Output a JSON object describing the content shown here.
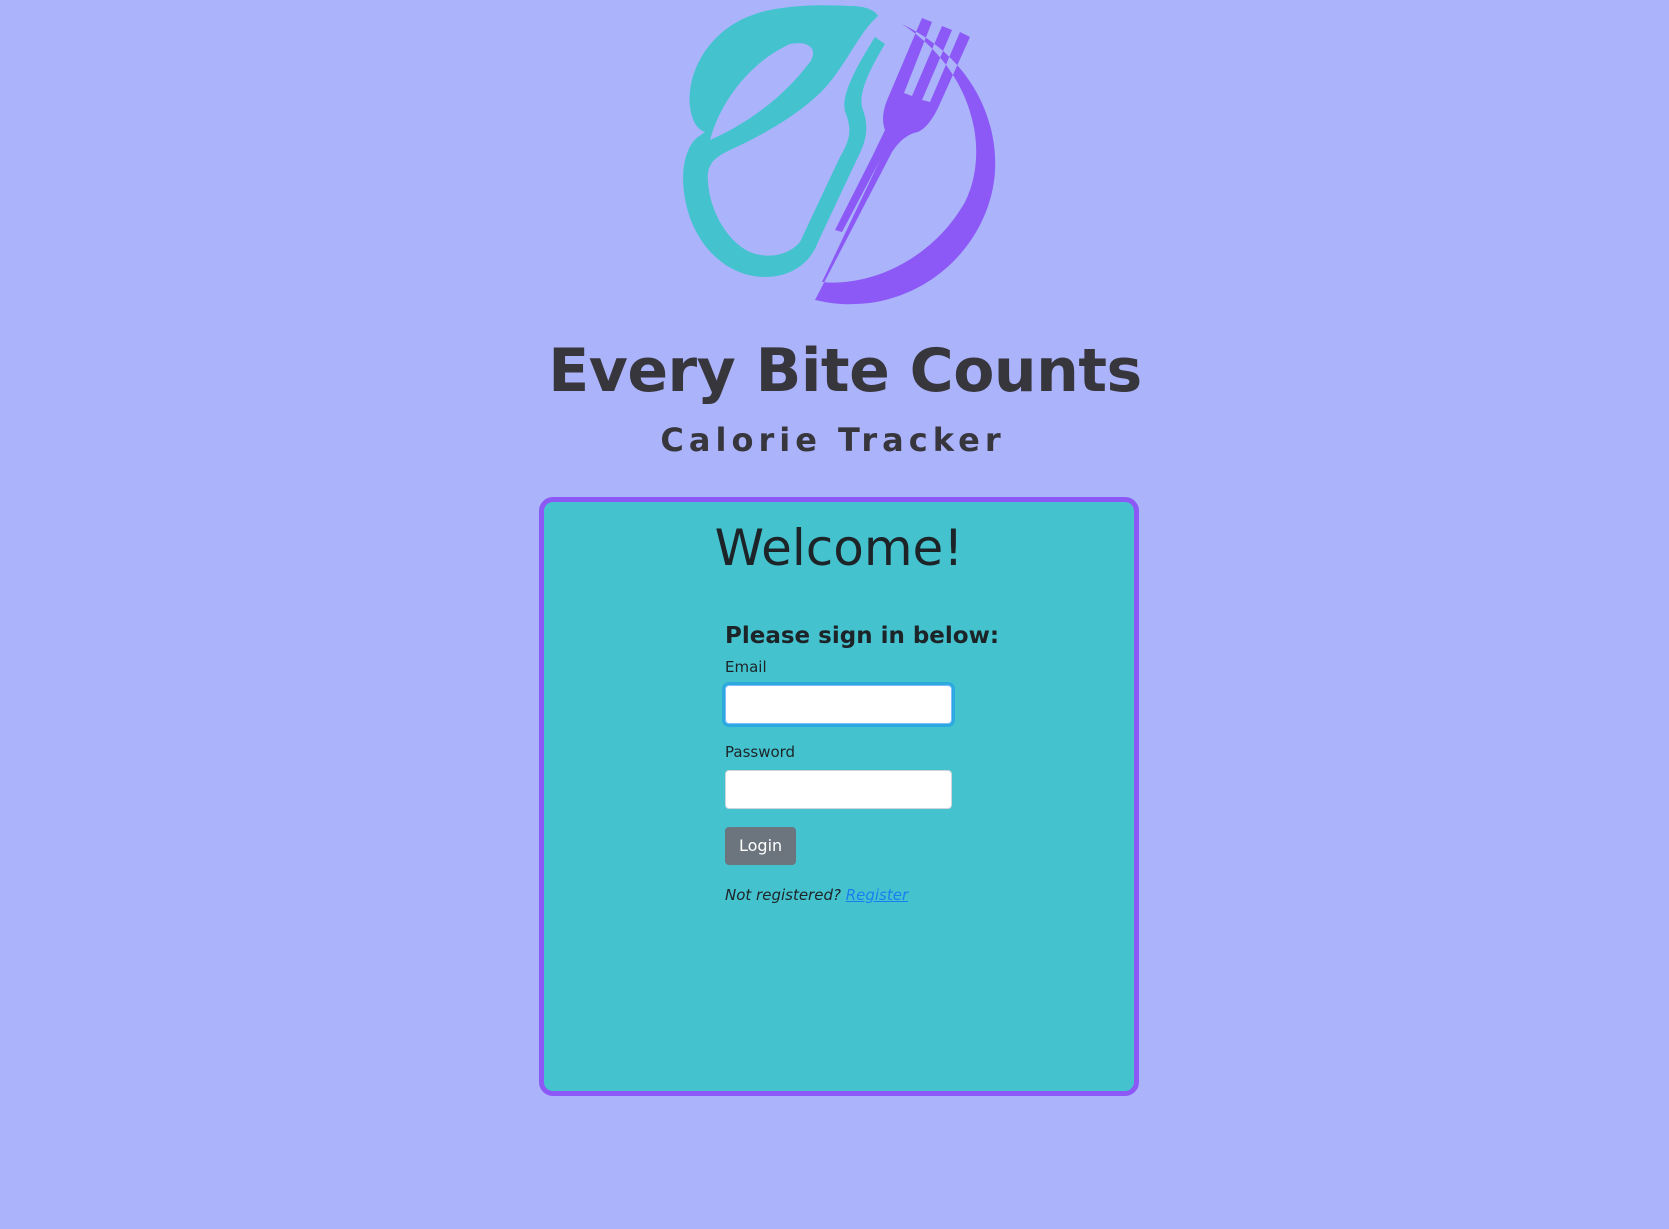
{
  "brand": {
    "title": "Every Bite Counts",
    "subtitle": "Calorie Tracker",
    "logo_icon": "leaf-spoon-fork-logo",
    "colors": {
      "background": "#abb3fa",
      "teal": "#44c3cf",
      "purple": "#8c59f6",
      "text": "#38363d"
    }
  },
  "card": {
    "heading": "Welcome!",
    "form_heading": "Please sign in below:",
    "email_label": "Email",
    "email_value": "",
    "password_label": "Password",
    "password_value": "",
    "login_label": "Login",
    "register_prompt": "Not registered?",
    "register_link": "Register"
  }
}
